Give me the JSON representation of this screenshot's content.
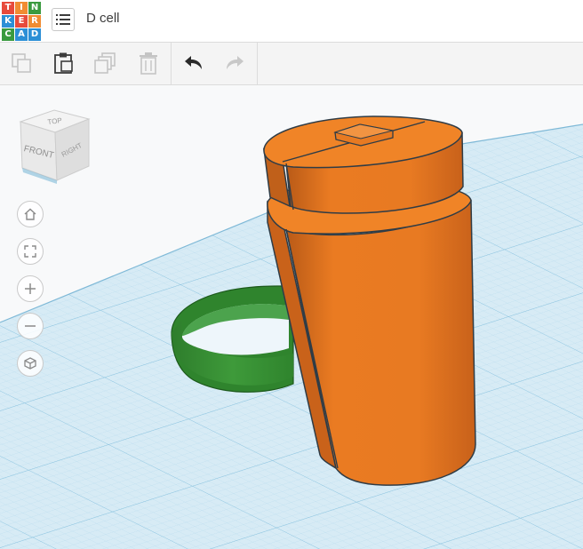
{
  "app": {
    "logo_letters": [
      "T",
      "I",
      "N",
      "K",
      "E",
      "R",
      "C",
      "A",
      "D"
    ],
    "logo_colors": [
      "#e74a3c",
      "#f08c33",
      "#3a9a3f",
      "#2c8fd6",
      "#e74a3c",
      "#f08c33",
      "#3a9a3f",
      "#2c8fd6",
      "#2c8fd6"
    ],
    "design_title": "D cell"
  },
  "toolbar": {
    "tools": [
      {
        "name": "copy-button",
        "icon": "copy-icon",
        "enabled": false
      },
      {
        "name": "paste-button",
        "icon": "paste-icon",
        "enabled": true
      },
      {
        "name": "duplicate-button",
        "icon": "duplicate-icon",
        "enabled": false
      },
      {
        "name": "delete-button",
        "icon": "trash-icon",
        "enabled": false
      },
      {
        "name": "undo-button",
        "icon": "undo-icon",
        "enabled": true
      },
      {
        "name": "redo-button",
        "icon": "redo-icon",
        "enabled": false
      }
    ]
  },
  "viewcube": {
    "top_label": "TOP",
    "front_label": "FRONT",
    "right_label": "RIGHT"
  },
  "view_controls": [
    {
      "name": "home-view-button",
      "icon": "home-icon"
    },
    {
      "name": "fit-view-button",
      "icon": "fit-icon"
    },
    {
      "name": "zoom-in-button",
      "icon": "plus-icon"
    },
    {
      "name": "zoom-out-button",
      "icon": "minus-icon"
    },
    {
      "name": "projection-button",
      "icon": "cube-icon"
    }
  ],
  "colors": {
    "orange": "#ed7f22",
    "orange_dark": "#c9611a",
    "green": "#3e9a3a",
    "grid_line": "#a9d4ea",
    "plane": "#d8ecf6"
  }
}
